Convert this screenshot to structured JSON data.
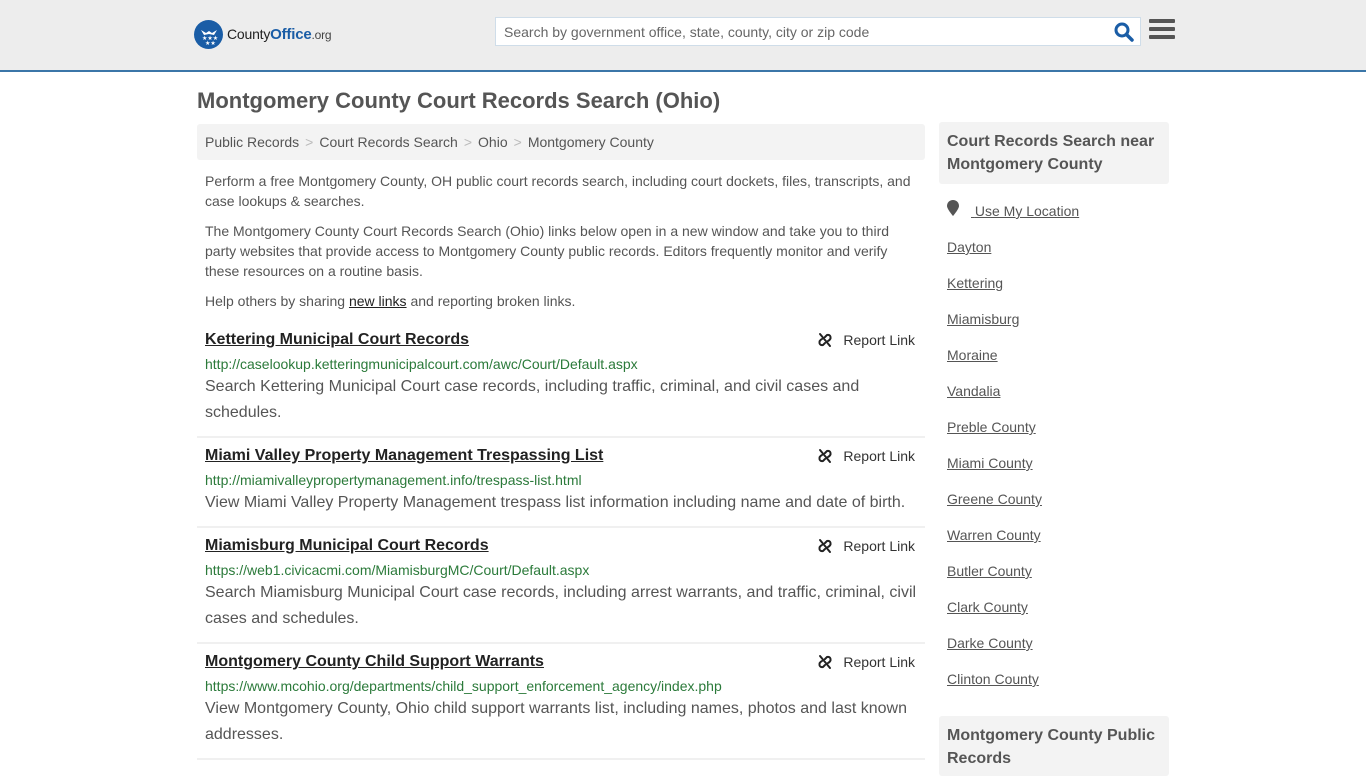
{
  "header": {
    "logo": {
      "county": "County",
      "office": "Office",
      "org": ".org"
    },
    "search": {
      "placeholder": "Search by government office, state, county, city or zip code",
      "value": ""
    },
    "icons": {
      "search": "search-icon",
      "menu": "hamburger-menu-icon",
      "logo": "eagle-stars-badge"
    },
    "colors": {
      "brand": "#1a5da6",
      "header_border": "#3b76a8"
    }
  },
  "page": {
    "title": "Montgomery County Court Records Search (Ohio)"
  },
  "breadcrumb": [
    {
      "label": "Public Records"
    },
    {
      "label": "Court Records Search"
    },
    {
      "label": "Ohio"
    },
    {
      "label": "Montgomery County"
    }
  ],
  "breadcrumb_separator": ">",
  "intro": {
    "p1": "Perform a free Montgomery County, OH public court records search, including court dockets, files, transcripts, and case lookups & searches.",
    "p2": "The Montgomery County Court Records Search (Ohio) links below open in a new window and take you to third party websites that provide access to Montgomery County public records. Editors frequently monitor and verify these resources on a routine basis.",
    "p3_before": "Help others by sharing ",
    "p3_link": "new links",
    "p3_after": " and reporting broken links."
  },
  "results": [
    {
      "title": "Kettering Municipal Court Records",
      "url": "http://caselookup.ketteringmunicipalcourt.com/awc/Court/Default.aspx",
      "description": "Search Kettering Municipal Court case records, including traffic, criminal, and civil cases and schedules.",
      "report_label": "Report Link"
    },
    {
      "title": "Miami Valley Property Management Trespassing List",
      "url": "http://miamivalleypropertymanagement.info/trespass-list.html",
      "description": "View Miami Valley Property Management trespass list information including name and date of birth.",
      "report_label": "Report Link"
    },
    {
      "title": "Miamisburg Municipal Court Records",
      "url": "https://web1.civicacmi.com/MiamisburgMC/Court/Default.aspx",
      "description": "Search Miamisburg Municipal Court case records, including arrest warrants, and traffic, criminal, civil cases and schedules.",
      "report_label": "Report Link"
    },
    {
      "title": "Montgomery County Child Support Warrants",
      "url": "https://www.mcohio.org/departments/child_support_enforcement_agency/index.php",
      "description": "View Montgomery County, Ohio child support warrants list, including names, photos and last known addresses.",
      "report_label": "Report Link"
    }
  ],
  "sidebar": {
    "heading": "Court Records Search near Montgomery County",
    "use_location": "Use My Location",
    "links": [
      "Dayton",
      "Kettering",
      "Miamisburg",
      "Moraine",
      "Vandalia",
      "Preble County",
      "Miami County",
      "Greene County",
      "Warren County",
      "Butler County",
      "Clark County",
      "Darke County",
      "Clinton County"
    ],
    "heading2": "Montgomery County Public Records"
  }
}
